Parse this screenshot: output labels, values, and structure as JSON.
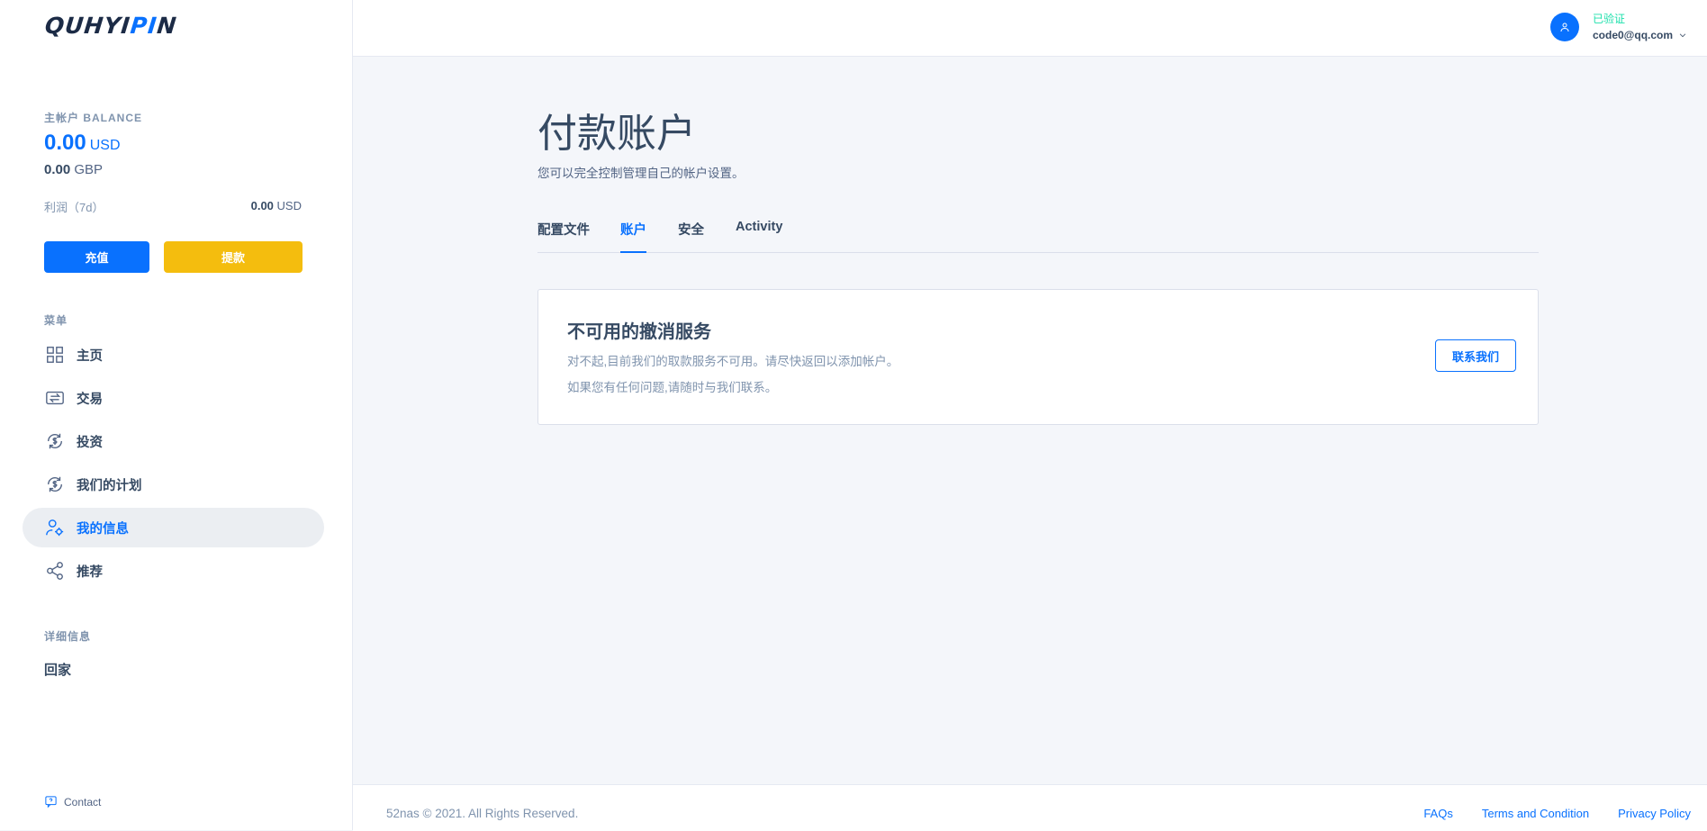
{
  "brand": {
    "prefix": "QUHYI",
    "highlight": "PI",
    "suffix": "N"
  },
  "balance": {
    "label": "主帐户 BALANCE",
    "usd_amount": "0.00",
    "usd_currency": "USD",
    "gbp_amount": "0.00",
    "gbp_currency": "GBP",
    "profit_label": "利润（7d）",
    "profit_amount": "0.00",
    "profit_currency": "USD"
  },
  "actions": {
    "deposit": "充值",
    "withdraw": "提款"
  },
  "menu": {
    "title": "菜单",
    "items": [
      {
        "label": "主页",
        "icon": "dashboard-icon"
      },
      {
        "label": "交易",
        "icon": "transactions-icon"
      },
      {
        "label": "投资",
        "icon": "invest-icon"
      },
      {
        "label": "我们的计划",
        "icon": "plans-icon"
      },
      {
        "label": "我的信息",
        "icon": "user-settings-icon",
        "active": true
      },
      {
        "label": "推荐",
        "icon": "share-icon"
      }
    ]
  },
  "details": {
    "title": "详细信息",
    "home_link": "回家"
  },
  "contact": "Contact",
  "user": {
    "status": "已验证",
    "email": "code0@qq.com"
  },
  "page": {
    "title": "付款账户",
    "subtitle": "您可以完全控制管理自己的帐户设置。",
    "tabs": [
      "配置文件",
      "账户",
      "安全",
      "Activity"
    ],
    "active_tab": "账户"
  },
  "card": {
    "title": "不可用的撤消服务",
    "text1": "对不起,目前我们的取款服务不可用。请尽快返回以添加帐户。",
    "text2": "如果您有任何问题,请随时与我们联系。",
    "button": "联系我们"
  },
  "footer": {
    "copyright": "52nas © 2021. All Rights Reserved.",
    "links": [
      "FAQs",
      "Terms and Condition",
      "Privacy Policy"
    ]
  },
  "colors": {
    "accent": "#0971fe",
    "warning": "#f4bd0e",
    "success": "#1ee0ac"
  }
}
